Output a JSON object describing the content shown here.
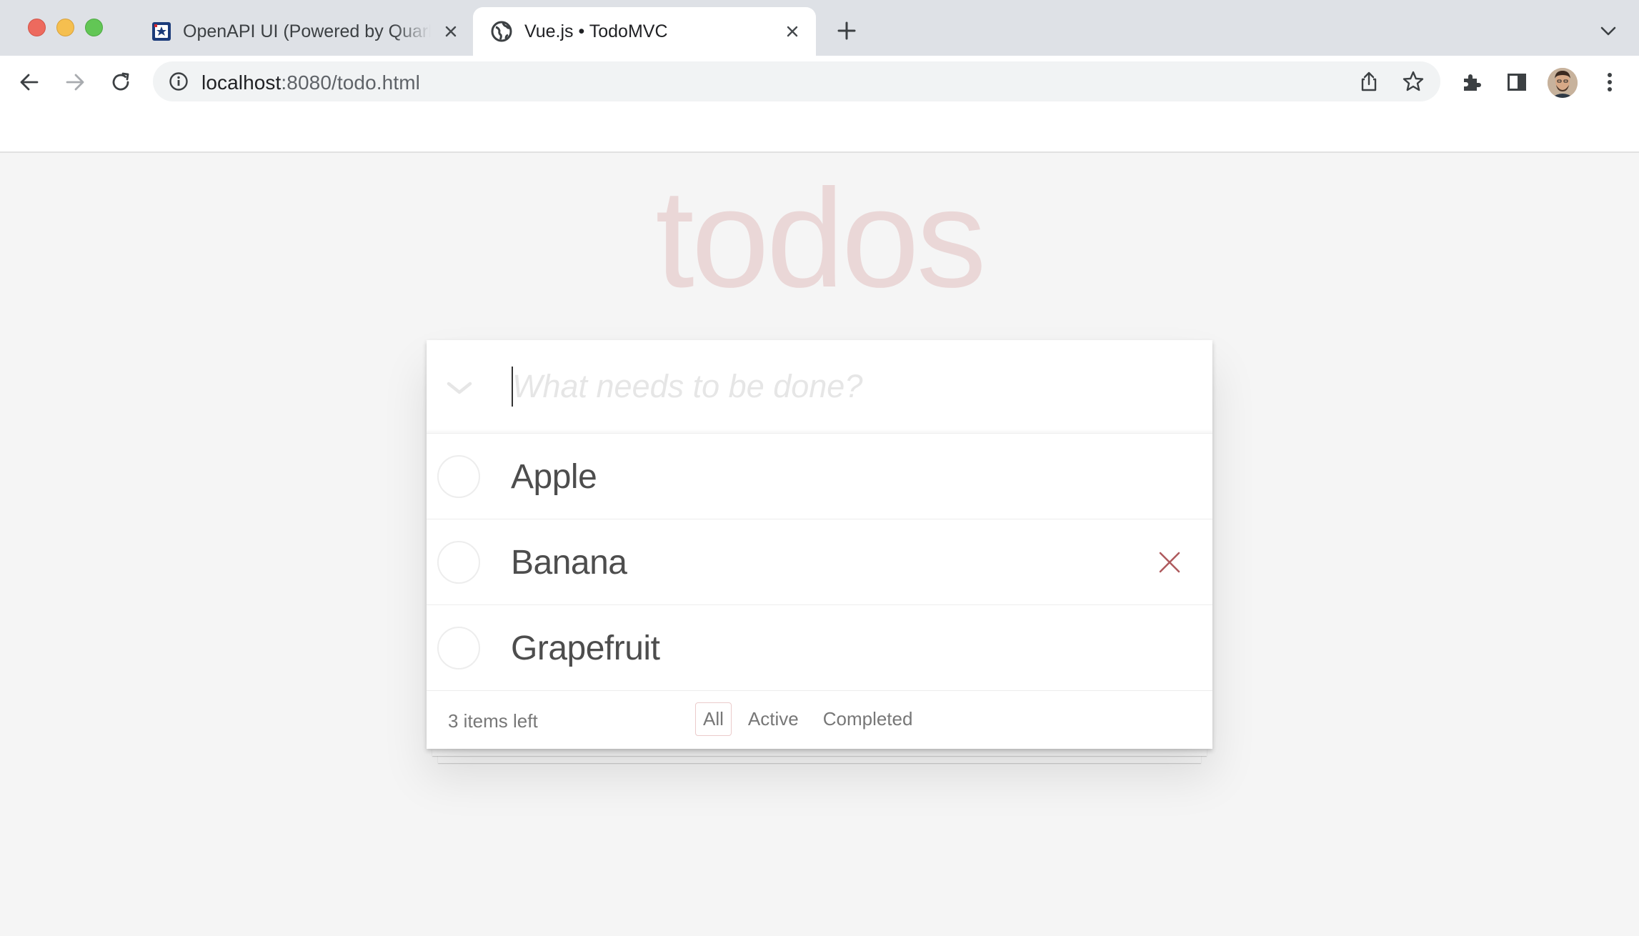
{
  "browser": {
    "tabs": [
      {
        "title": "OpenAPI UI (Powered by Quarkus)",
        "active": false
      },
      {
        "title": "Vue.js • TodoMVC",
        "active": true
      }
    ],
    "url_host": "localhost",
    "url_rest": ":8080/todo.html"
  },
  "app": {
    "title": "todos",
    "new_todo_placeholder": "What needs to be done?",
    "new_todo_value": "",
    "todos": [
      {
        "label": "Apple",
        "completed": false
      },
      {
        "label": "Banana",
        "completed": false
      },
      {
        "label": "Grapefruit",
        "completed": false
      }
    ],
    "footer": {
      "items_left": "3 items left",
      "filters": [
        "All",
        "Active",
        "Completed"
      ],
      "selected_filter": "All"
    },
    "colors": {
      "title": "#af2f2f",
      "destroy": "#af5b5e",
      "text": "#4d4d4d",
      "footer_text": "#777777"
    }
  }
}
